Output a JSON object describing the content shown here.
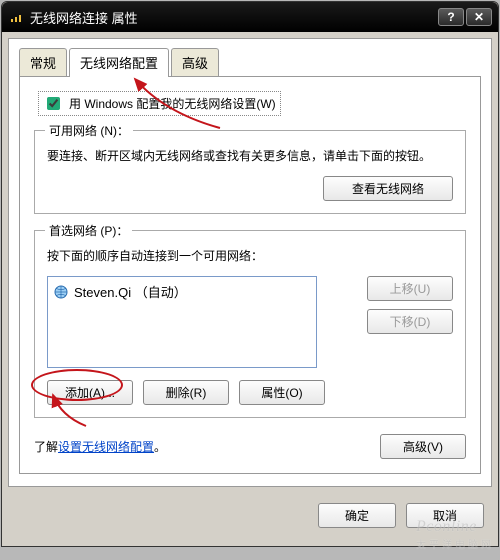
{
  "window": {
    "title": "无线网络连接 属性"
  },
  "tabs": {
    "general": "常规",
    "wireless": "无线网络配置",
    "advanced": "高级"
  },
  "checkbox": {
    "label": "用 Windows 配置我的无线网络设置(W)"
  },
  "available": {
    "title": "可用网络 (N)：",
    "desc": "要连接、断开区域内无线网络或查找有关更多信息，请单击下面的按钮。",
    "view_btn": "查看无线网络"
  },
  "preferred": {
    "title": "首选网络 (P)：",
    "desc": "按下面的顺序自动连接到一个可用网络：",
    "items": [
      {
        "label": "Steven.Qi （自动）"
      }
    ],
    "move_up": "上移(U)",
    "move_down": "下移(D)",
    "add": "添加(A)...",
    "remove": "删除(R)",
    "props": "属性(O)"
  },
  "learn": {
    "prefix": "了解",
    "link": "设置无线网络配置",
    "suffix": "。",
    "adv_btn": "高级(V)"
  },
  "footer": {
    "ok": "确定",
    "cancel": "取消"
  },
  "watermark": {
    "brand": "Pconline",
    "cn": "太平洋电脑网"
  }
}
